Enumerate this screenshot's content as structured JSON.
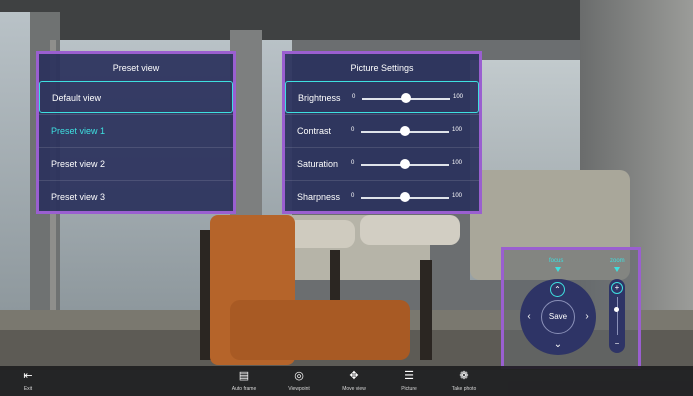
{
  "preset_panel": {
    "title": "Preset view",
    "items": [
      {
        "label": "Default view"
      },
      {
        "label": "Preset view 1"
      },
      {
        "label": "Preset view 2"
      },
      {
        "label": "Preset view 3"
      }
    ]
  },
  "picture_panel": {
    "title": "Picture Settings",
    "rows": [
      {
        "label": "Brightness",
        "min": "0",
        "max": "100",
        "value": 50
      },
      {
        "label": "Contrast",
        "min": "0",
        "max": "100",
        "value": 50
      },
      {
        "label": "Saturation",
        "min": "0",
        "max": "100",
        "value": 50
      },
      {
        "label": "Sharpness",
        "min": "0",
        "max": "100",
        "value": 50
      }
    ]
  },
  "camera_control": {
    "focus_label": "focus",
    "zoom_label": "zoom",
    "save_label": "Save",
    "icons": {
      "up": "chevron-up-icon",
      "down": "chevron-down-icon",
      "left": "chevron-left-icon",
      "right": "chevron-right-icon",
      "zoom_in": "zoom-in-icon",
      "zoom_out": "zoom-out-icon"
    }
  },
  "toolbar": {
    "exit": "Exit",
    "auto_frame": "Auto frame",
    "viewpoint": "Viewpoint",
    "move_view": "Move view",
    "picture": "Picture",
    "take_photo": "Take photo"
  },
  "colors": {
    "accent": "#3ee0e0",
    "panel": "#2b325c",
    "highlight_border": "#9a5fd0"
  }
}
